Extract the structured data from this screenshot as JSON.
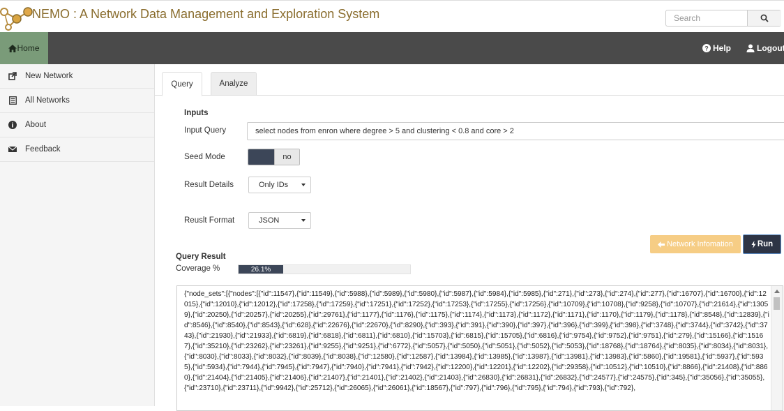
{
  "header": {
    "title": "NEMO : A Network Data Management and Exploration System",
    "search_placeholder": "Search"
  },
  "nav": {
    "home": "Home",
    "help": "Help",
    "logout": "Logout"
  },
  "sidebar": {
    "items": [
      {
        "label": "New Network",
        "icon": "external-link-icon"
      },
      {
        "label": "All Networks",
        "icon": "list-icon"
      },
      {
        "label": "About",
        "icon": "info-circle-icon"
      },
      {
        "label": "Feedback",
        "icon": "envelope-icon"
      }
    ]
  },
  "tabs": {
    "query": "Query",
    "analyze": "Analyze"
  },
  "form": {
    "inputs_heading": "Inputs",
    "input_query_label": "Input Query",
    "input_query_value": "select nodes from enron where degree > 5 and clustering < 0.8 and core > 2",
    "seed_mode_label": "Seed Mode",
    "seed_mode_value": "no",
    "result_details_label": "Result Details",
    "result_details_value": "Only IDs",
    "result_format_label": "Reuslt Format",
    "result_format_value": "JSON",
    "network_info_button": "Network Infomation",
    "run_button": "Run"
  },
  "result": {
    "heading": "Query Result",
    "coverage_label": "Coverage %",
    "coverage_text": "26.1%",
    "coverage_fraction": 0.261,
    "text": "{\"node_sets\":[{\"nodes\":[{\"id\":11547},{\"id\":11549},{\"id\":5988},{\"id\":5989},{\"id\":5980},{\"id\":5987},{\"id\":5984},{\"id\":5985},{\"id\":271},{\"id\":273},{\"id\":274},{\"id\":277},{\"id\":16707},{\"id\":16700},{\"id\":12015},{\"id\":12010},{\"id\":12012},{\"id\":17258},{\"id\":17259},{\"id\":17251},{\"id\":17252},{\"id\":17253},{\"id\":17255},{\"id\":17256},{\"id\":10709},{\"id\":10708},{\"id\":9258},{\"id\":10707},{\"id\":21614},{\"id\":13059},{\"id\":20250},{\"id\":20257},{\"id\":20255},{\"id\":29761},{\"id\":1177},{\"id\":1176},{\"id\":1175},{\"id\":1174},{\"id\":1173},{\"id\":1172},{\"id\":1171},{\"id\":1170},{\"id\":1179},{\"id\":1178},{\"id\":8548},{\"id\":12839},{\"id\":8546},{\"id\":8540},{\"id\":8543},{\"id\":628},{\"id\":22676},{\"id\":22670},{\"id\":8290},{\"id\":393},{\"id\":391},{\"id\":390},{\"id\":397},{\"id\":396},{\"id\":399},{\"id\":398},{\"id\":3748},{\"id\":3744},{\"id\":3742},{\"id\":3743},{\"id\":21930},{\"id\":21933},{\"id\":6819},{\"id\":6818},{\"id\":6811},{\"id\":6810},{\"id\":15703},{\"id\":6815},{\"id\":15705},{\"id\":6816},{\"id\":9754},{\"id\":9752},{\"id\":9751},{\"id\":279},{\"id\":15166},{\"id\":15167},{\"id\":35210},{\"id\":23262},{\"id\":23261},{\"id\":9255},{\"id\":9251},{\"id\":6772},{\"id\":5057},{\"id\":5050},{\"id\":5051},{\"id\":5052},{\"id\":5053},{\"id\":18768},{\"id\":18764},{\"id\":8035},{\"id\":8034},{\"id\":8031},{\"id\":8030},{\"id\":8033},{\"id\":8032},{\"id\":8039},{\"id\":8038},{\"id\":12580},{\"id\":12587},{\"id\":13984},{\"id\":13985},{\"id\":13987},{\"id\":13981},{\"id\":13983},{\"id\":5860},{\"id\":19581},{\"id\":5937},{\"id\":5935},{\"id\":5934},{\"id\":7944},{\"id\":7945},{\"id\":7947},{\"id\":7940},{\"id\":7941},{\"id\":7942},{\"id\":12200},{\"id\":12201},{\"id\":12202},{\"id\":29358},{\"id\":10512},{\"id\":10510},{\"id\":8866},{\"id\":21408},{\"id\":8860},{\"id\":21404},{\"id\":21405},{\"id\":21406},{\"id\":21407},{\"id\":21401},{\"id\":21402},{\"id\":21403},{\"id\":26830},{\"id\":26831},{\"id\":26832},{\"id\":24577},{\"id\":24575},{\"id\":345},{\"id\":35056},{\"id\":35055},{\"id\":23710},{\"id\":23711},{\"id\":9942},{\"id\":25712},{\"id\":26065},{\"id\":26061},{\"id\":18567},{\"id\":797},{\"id\":796},{\"id\":795},{\"id\":794},{\"id\":793},{\"id\":792},"
  },
  "colors": {
    "title": "#8a6d2e",
    "navbar": "#4a4a4a",
    "home_tab": "#7a9b79",
    "accent_dark": "#3c4658",
    "network_info_button": "#f6cd85"
  }
}
